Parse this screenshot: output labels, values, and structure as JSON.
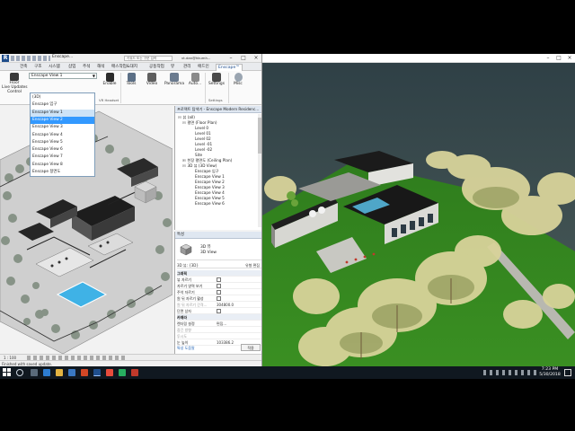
{
  "revit": {
    "app_logo": "R",
    "doc_tab": "Enscape...",
    "search_placeholder": "키워드 또는 구문 입력",
    "user": "vt.dan@hkumh...",
    "ribbon_tabs": [
      "건축",
      "구조",
      "시스템",
      "삽입",
      "주석",
      "해석",
      "매스작업&대지",
      "공동작업",
      "뷰",
      "관리",
      "애드인",
      "Enscape™"
    ],
    "ribbon_buttons": {
      "floor_live_updates_l1": "Floor",
      "floor_live_updates_l2": "Live Updates",
      "control": "Control",
      "enable": "Enable",
      "vr_headset": "VR Headset",
      "tools": "Tools",
      "video": "Video",
      "panorama": "Panorama",
      "auto": "Auto...",
      "settings": "Settings",
      "settings_group": "Settings",
      "misc": "Misc"
    },
    "view_select_value": "Enscape View 1",
    "dropdown_items": [
      "(3D)",
      "Enscape 입구",
      "Enscape View 1",
      "Enscape View 2",
      "Enscape View 3",
      "Enscape View 4",
      "Enscape View 5",
      "Enscape View 6",
      "Enscape View 7",
      "Enscape View 8",
      "Enscape 정면도"
    ],
    "project_browser": {
      "title": "프로젝트 탐색기 - Enscape Modern Residenc...",
      "items": [
        {
          "toggle": "⊟",
          "label": "뷰 (all)"
        },
        {
          "toggle": "⊟",
          "label": "평면 (Floor Plan)"
        },
        {
          "toggle": "",
          "label": "Level 0"
        },
        {
          "toggle": "",
          "label": "Level 01"
        },
        {
          "toggle": "",
          "label": "Level 02"
        },
        {
          "toggle": "",
          "label": "Level -01"
        },
        {
          "toggle": "",
          "label": "Level -02"
        },
        {
          "toggle": "",
          "label": "Site"
        },
        {
          "toggle": "⊞",
          "label": "천장 평면도 (Ceiling Plan)"
        },
        {
          "toggle": "⊟",
          "label": "3D 뷰 (3D View)"
        },
        {
          "toggle": "",
          "label": "Enscape 입구"
        },
        {
          "toggle": "",
          "label": "Enscape View 1"
        },
        {
          "toggle": "",
          "label": "Enscape View 2"
        },
        {
          "toggle": "",
          "label": "Enscape View 3"
        },
        {
          "toggle": "",
          "label": "Enscape View 4"
        },
        {
          "toggle": "",
          "label": "Enscape View 5"
        },
        {
          "toggle": "",
          "label": "Enscape View 6"
        }
      ]
    },
    "properties": {
      "title": "특성",
      "type_line1": "3D 뷰",
      "type_line2": "3D View",
      "selector": "3D 뷰: {3D}",
      "edit_type": "유형 편집",
      "rows": [
        {
          "label": "그래픽",
          "kind": "group",
          "value": ""
        },
        {
          "label": "뷰 자르기",
          "kind": "check",
          "value": ""
        },
        {
          "label": "자르기 영역 보기",
          "kind": "check",
          "value": ""
        },
        {
          "label": "주석 자르기",
          "kind": "check",
          "value": ""
        },
        {
          "label": "원 뒤 자르기 활성",
          "kind": "check",
          "value": ""
        },
        {
          "label": "원 뒤 자르기 간격...",
          "kind": "disabled",
          "value": "304800.0"
        },
        {
          "label": "단면 상자",
          "kind": "check",
          "value": ""
        },
        {
          "label": "카메라",
          "kind": "group",
          "value": ""
        },
        {
          "label": "렌더링 설정",
          "kind": "text",
          "value": "편집..."
        },
        {
          "label": "잠긴 방향",
          "kind": "disabled",
          "value": ""
        },
        {
          "label": "투시도",
          "kind": "disabled",
          "value": ""
        },
        {
          "label": "눈 높이",
          "kind": "text",
          "value": "103386.2"
        },
        {
          "label": "대상 높이",
          "kind": "text",
          "value": ""
        }
      ],
      "help_link": "특성 도움말",
      "apply": "적용"
    },
    "view_scale": "1 : 100",
    "status_text": "Finished with saved update."
  },
  "taskbar": {
    "time": "7:23 PM",
    "date": "5/30/2018"
  },
  "colors": {
    "revit_blue": "#1f4e8c",
    "dropdown_selected": "#3399ff",
    "dropdown_hover": "#cde3f7",
    "grass": "#2f7d1d",
    "tree_yellow": "#d8d39a",
    "taskbar": "#101820"
  }
}
